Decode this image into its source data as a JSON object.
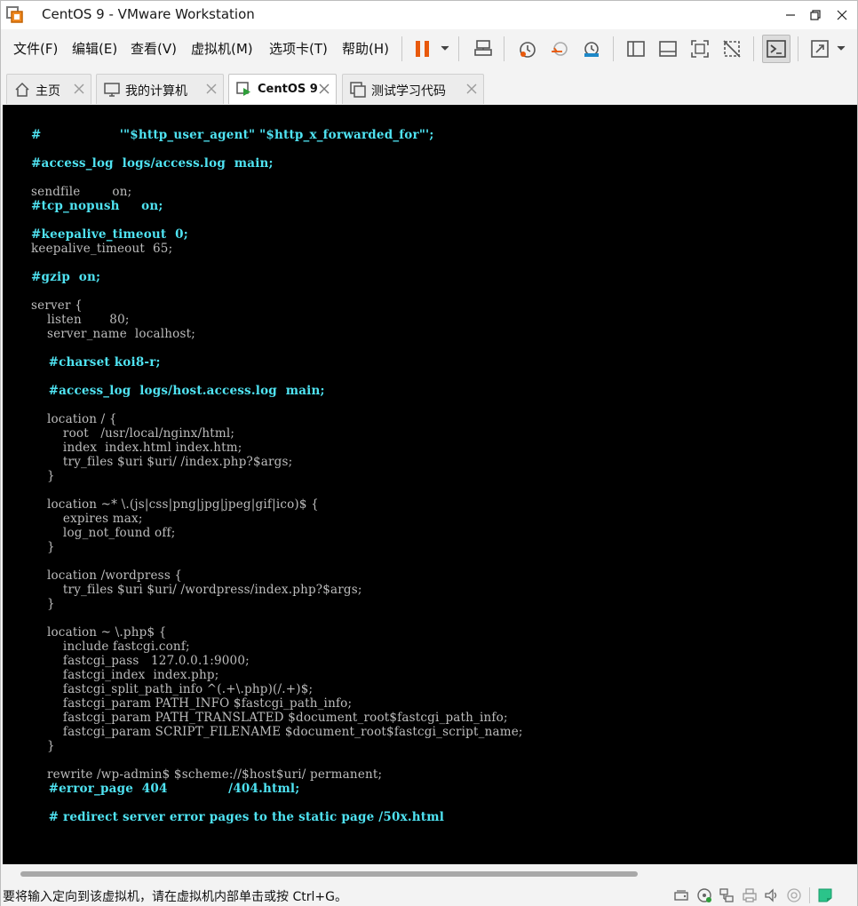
{
  "window": {
    "title": "CentOS 9 - VMware Workstation"
  },
  "menu": {
    "items": [
      "文件(F)",
      "编辑(E)",
      "查看(V)",
      "虚拟机(M)",
      "选项卡(T)",
      "帮助(H)"
    ]
  },
  "tabs": [
    {
      "label": "主页",
      "icon": "home-icon",
      "active": false
    },
    {
      "label": "我的计算机",
      "icon": "computer-icon",
      "active": false
    },
    {
      "label": "CentOS 9",
      "icon": "vm-running-icon",
      "active": true
    },
    {
      "label": "测试学习代码",
      "icon": "vm-icon",
      "active": false
    }
  ],
  "console": {
    "lines": [
      {
        "text": "#                  '\"$http_user_agent\" \"$http_x_forwarded_for\"';",
        "style": "cyan"
      },
      {
        "text": "",
        "style": "plain"
      },
      {
        "text": "#access_log  logs/access.log  main;",
        "style": "cyan"
      },
      {
        "text": "",
        "style": "plain"
      },
      {
        "text": "sendfile        on;",
        "style": "plain"
      },
      {
        "text": "#tcp_nopush     on;",
        "style": "cyan"
      },
      {
        "text": "",
        "style": "plain"
      },
      {
        "text": "#keepalive_timeout  0;",
        "style": "cyan"
      },
      {
        "text": "keepalive_timeout  65;",
        "style": "plain"
      },
      {
        "text": "",
        "style": "plain"
      },
      {
        "text": "#gzip  on;",
        "style": "cyan"
      },
      {
        "text": "",
        "style": "plain"
      },
      {
        "text": "server {",
        "style": "plain"
      },
      {
        "text": "    listen       80;",
        "style": "plain"
      },
      {
        "text": "    server_name  localhost;",
        "style": "plain"
      },
      {
        "text": "",
        "style": "plain"
      },
      {
        "text": "    #charset koi8-r;",
        "style": "cyan"
      },
      {
        "text": "",
        "style": "plain"
      },
      {
        "text": "    #access_log  logs/host.access.log  main;",
        "style": "cyan"
      },
      {
        "text": "",
        "style": "plain"
      },
      {
        "text": "    location / {",
        "style": "plain"
      },
      {
        "text": "        root   /usr/local/nginx/html;",
        "style": "plain"
      },
      {
        "text": "        index  index.html index.htm;",
        "style": "plain"
      },
      {
        "text": "        try_files $uri $uri/ /index.php?$args;",
        "style": "plain"
      },
      {
        "text": "    }",
        "style": "plain"
      },
      {
        "text": "",
        "style": "plain"
      },
      {
        "text": "    location ~* \\.(js|css|png|jpg|jpeg|gif|ico)$ {",
        "style": "plain"
      },
      {
        "text": "        expires max;",
        "style": "plain"
      },
      {
        "text": "        log_not_found off;",
        "style": "plain"
      },
      {
        "text": "    }",
        "style": "plain"
      },
      {
        "text": "",
        "style": "plain"
      },
      {
        "text": "    location /wordpress {",
        "style": "plain"
      },
      {
        "text": "        try_files $uri $uri/ /wordpress/index.php?$args;",
        "style": "plain"
      },
      {
        "text": "    }",
        "style": "plain"
      },
      {
        "text": "",
        "style": "plain"
      },
      {
        "text": "    location ~ \\.php$ {",
        "style": "plain"
      },
      {
        "text": "        include fastcgi.conf;",
        "style": "plain"
      },
      {
        "text": "        fastcgi_pass   127.0.0.1:9000;",
        "style": "plain"
      },
      {
        "text": "        fastcgi_index  index.php;",
        "style": "plain"
      },
      {
        "text": "        fastcgi_split_path_info ^(.+\\.php)(/.+)$;",
        "style": "plain"
      },
      {
        "text": "        fastcgi_param PATH_INFO $fastcgi_path_info;",
        "style": "plain"
      },
      {
        "text": "        fastcgi_param PATH_TRANSLATED $document_root$fastcgi_path_info;",
        "style": "plain"
      },
      {
        "text": "        fastcgi_param SCRIPT_FILENAME $document_root$fastcgi_script_name;",
        "style": "plain"
      },
      {
        "text": "    }",
        "style": "plain"
      },
      {
        "text": "",
        "style": "plain"
      },
      {
        "text": "    rewrite /wp-admin$ $scheme://$host$uri/ permanent;",
        "style": "plain"
      },
      {
        "text": "    #error_page  404              /404.html;",
        "style": "cyan"
      },
      {
        "text": "",
        "style": "plain"
      },
      {
        "text": "    # redirect server error pages to the static page /50x.html",
        "style": "cyan"
      }
    ]
  },
  "statusbar": {
    "message": "要将输入定向到该虚拟机，请在虚拟机内部单击或按 Ctrl+G。"
  },
  "colors": {
    "console_bg": "#000000",
    "console_text": "#bdbdbd",
    "comment_text": "#4fe3f2",
    "pause_accent": "#e8590c"
  }
}
